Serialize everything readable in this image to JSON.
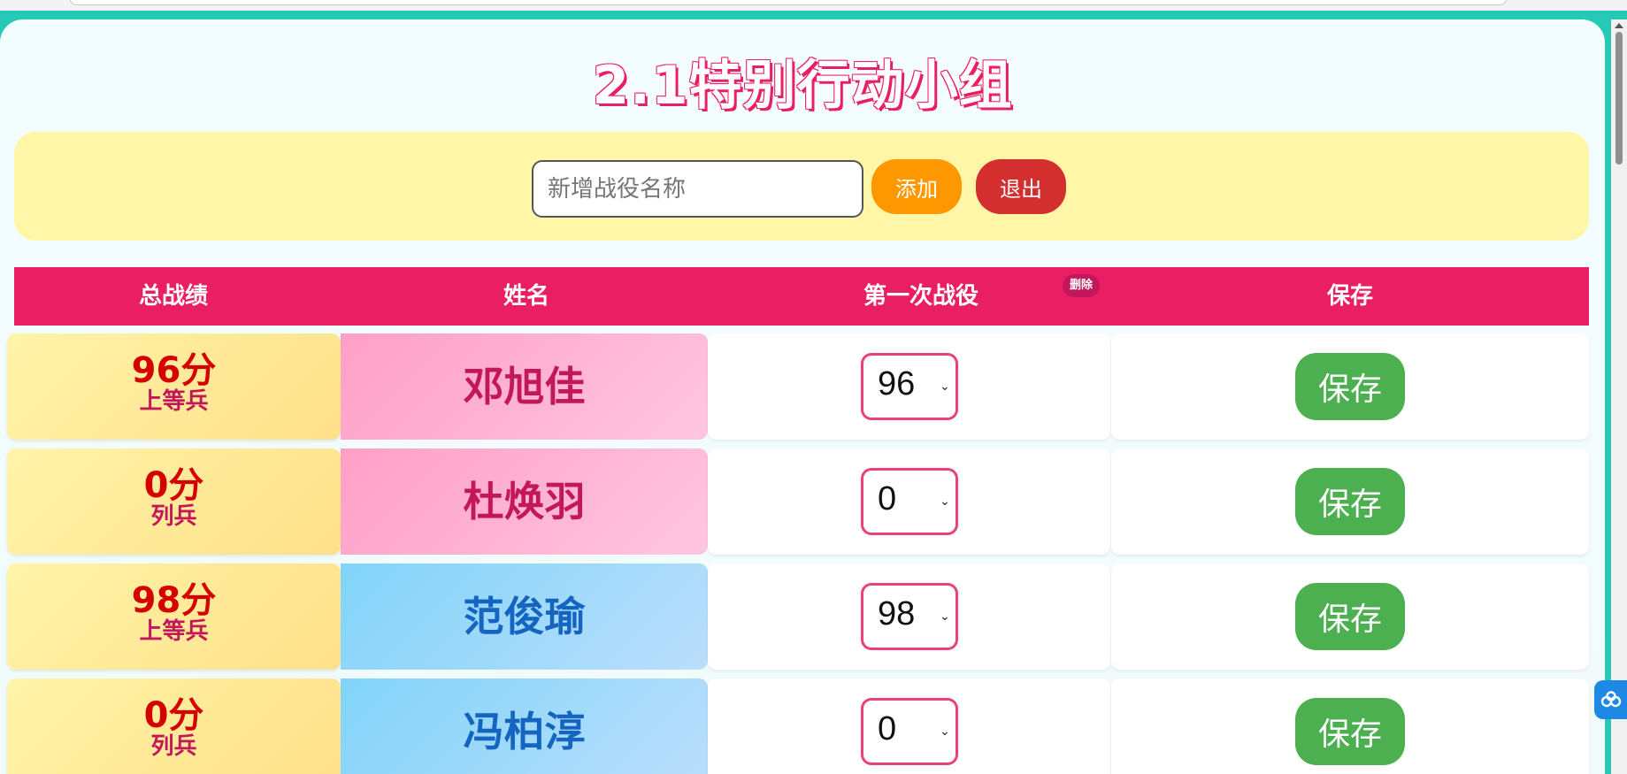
{
  "page": {
    "title": "2.1特别行动小组"
  },
  "toolbar": {
    "input_placeholder": "新增战役名称",
    "input_value": "",
    "add_label": "添加",
    "exit_label": "退出"
  },
  "table": {
    "headers": {
      "total": "总战绩",
      "name": "姓名",
      "campaign": "第一次战役",
      "save": "保存"
    },
    "delete_badge": "删除",
    "rows": [
      {
        "score": "96分",
        "rank": "上等兵",
        "name": "邓旭佳",
        "name_color": "pink",
        "selected": "96",
        "save_label": "保存"
      },
      {
        "score": "0分",
        "rank": "列兵",
        "name": "杜焕羽",
        "name_color": "pink",
        "selected": "0",
        "save_label": "保存"
      },
      {
        "score": "98分",
        "rank": "上等兵",
        "name": "范俊瑜",
        "name_color": "blue",
        "selected": "98",
        "save_label": "保存"
      },
      {
        "score": "0分",
        "rank": "列兵",
        "name": "冯柏淳",
        "name_color": "blue",
        "selected": "0",
        "save_label": "保存"
      }
    ]
  },
  "colors": {
    "accent": "#e91e63",
    "toolbar_bg": "#fff6a8",
    "add": "#ff9800",
    "exit": "#d32f2f",
    "save": "#4caf50",
    "frame": "#25c9b5"
  },
  "icons": {
    "float_widget": "cloud-link-icon",
    "select_arrow": "chevron-down-icon"
  }
}
